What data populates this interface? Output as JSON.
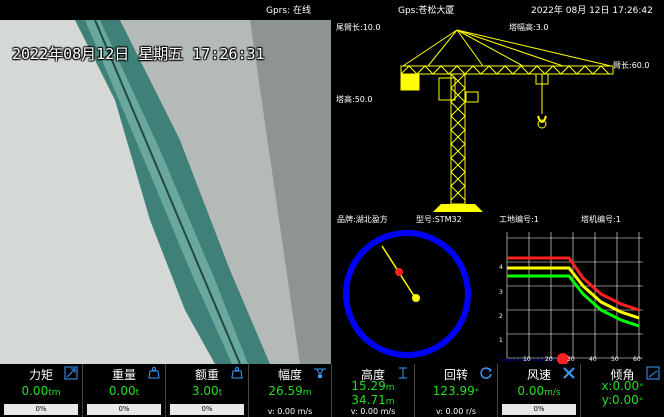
{
  "status_bar": {
    "gprs": "Gprs: 在线",
    "gps": "Gps:苍松大厦",
    "datetime": "2022年 08月 12日 17:26:42"
  },
  "camera": {
    "timestamp": "2022年08月12日  星期五  17:26:31"
  },
  "crane": {
    "tail_length": "尾臂长:10.0",
    "amplitude": "塔幅高:3.0",
    "jib_length": "臂长:60.0",
    "tower_height": "塔高:50.0"
  },
  "info": {
    "brand": "品牌:湖北盈方",
    "model": "型号:STM32",
    "site_id": "工地编号:1",
    "crane_id": "塔机编号:1"
  },
  "curve_chart": {
    "x_ticks": [
      "0",
      "10",
      "20",
      "30",
      "40",
      "50",
      "60"
    ],
    "y_ticks": [
      "1",
      "2",
      "3",
      "4",
      "5"
    ],
    "colors": {
      "red": "#ff2020",
      "yellow": "#ffff00",
      "green": "#00ff00"
    }
  },
  "metrics": [
    {
      "title": "力矩",
      "value": "0.00",
      "unit": "tm",
      "percent": "0%",
      "icon": "moment-icon"
    },
    {
      "title": "重量",
      "value": "0.00",
      "unit": "t",
      "percent": "0%",
      "icon": "weight-icon"
    },
    {
      "title": "额重",
      "value": "3.00",
      "unit": "t",
      "percent": "0%",
      "icon": "rated-weight-icon"
    },
    {
      "title": "幅度",
      "value": "26.59",
      "unit": "m",
      "sub": "v: 0.00 m/s",
      "icon": "trolley-icon"
    },
    {
      "title": "高度",
      "value": "15.29",
      "unit": "m",
      "value2": "34.71",
      "unit2": "m",
      "sub": "v: 0.00 m/s",
      "icon": "height-icon"
    },
    {
      "title": "回转",
      "value": "123.99",
      "unit": "°",
      "sub": "v: 0.00 r/s",
      "icon": "rotate-icon"
    },
    {
      "title": "风速",
      "value": "0.00",
      "unit": "m/s",
      "percent": "0%",
      "icon": "wind-icon"
    },
    {
      "title": "倾角",
      "value": "x:0.00",
      "unit": "°",
      "value2": "y:0.00",
      "unit2": "°",
      "icon": "tilt-icon"
    }
  ],
  "accent_colors": {
    "value_green": "#22dd22",
    "crane_yellow": "#ffff00",
    "ring_blue": "#0000ff"
  }
}
